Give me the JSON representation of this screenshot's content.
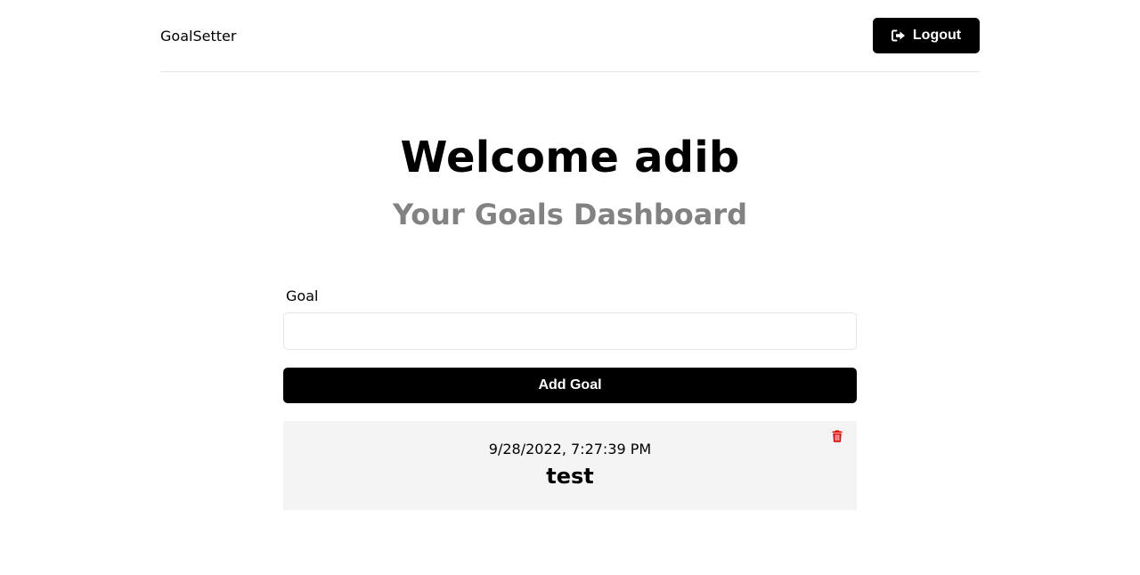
{
  "header": {
    "brand": "GoalSetter",
    "logout_label": "Logout",
    "logout_icon": "sign-out-icon"
  },
  "heading": {
    "welcome": "Welcome adib",
    "subtitle": "Your Goals Dashboard"
  },
  "form": {
    "goal_label": "Goal",
    "goal_value": "",
    "goal_placeholder": "",
    "submit_label": "Add Goal"
  },
  "goals": [
    {
      "date": "9/28/2022, 7:27:39 PM",
      "text": "test",
      "delete_icon": "trash-icon"
    }
  ],
  "colors": {
    "primary": "#000000",
    "subtitle": "#828282",
    "card_bg": "#f4f4f4",
    "delete": "#e60000",
    "border": "#e6e6e6"
  }
}
